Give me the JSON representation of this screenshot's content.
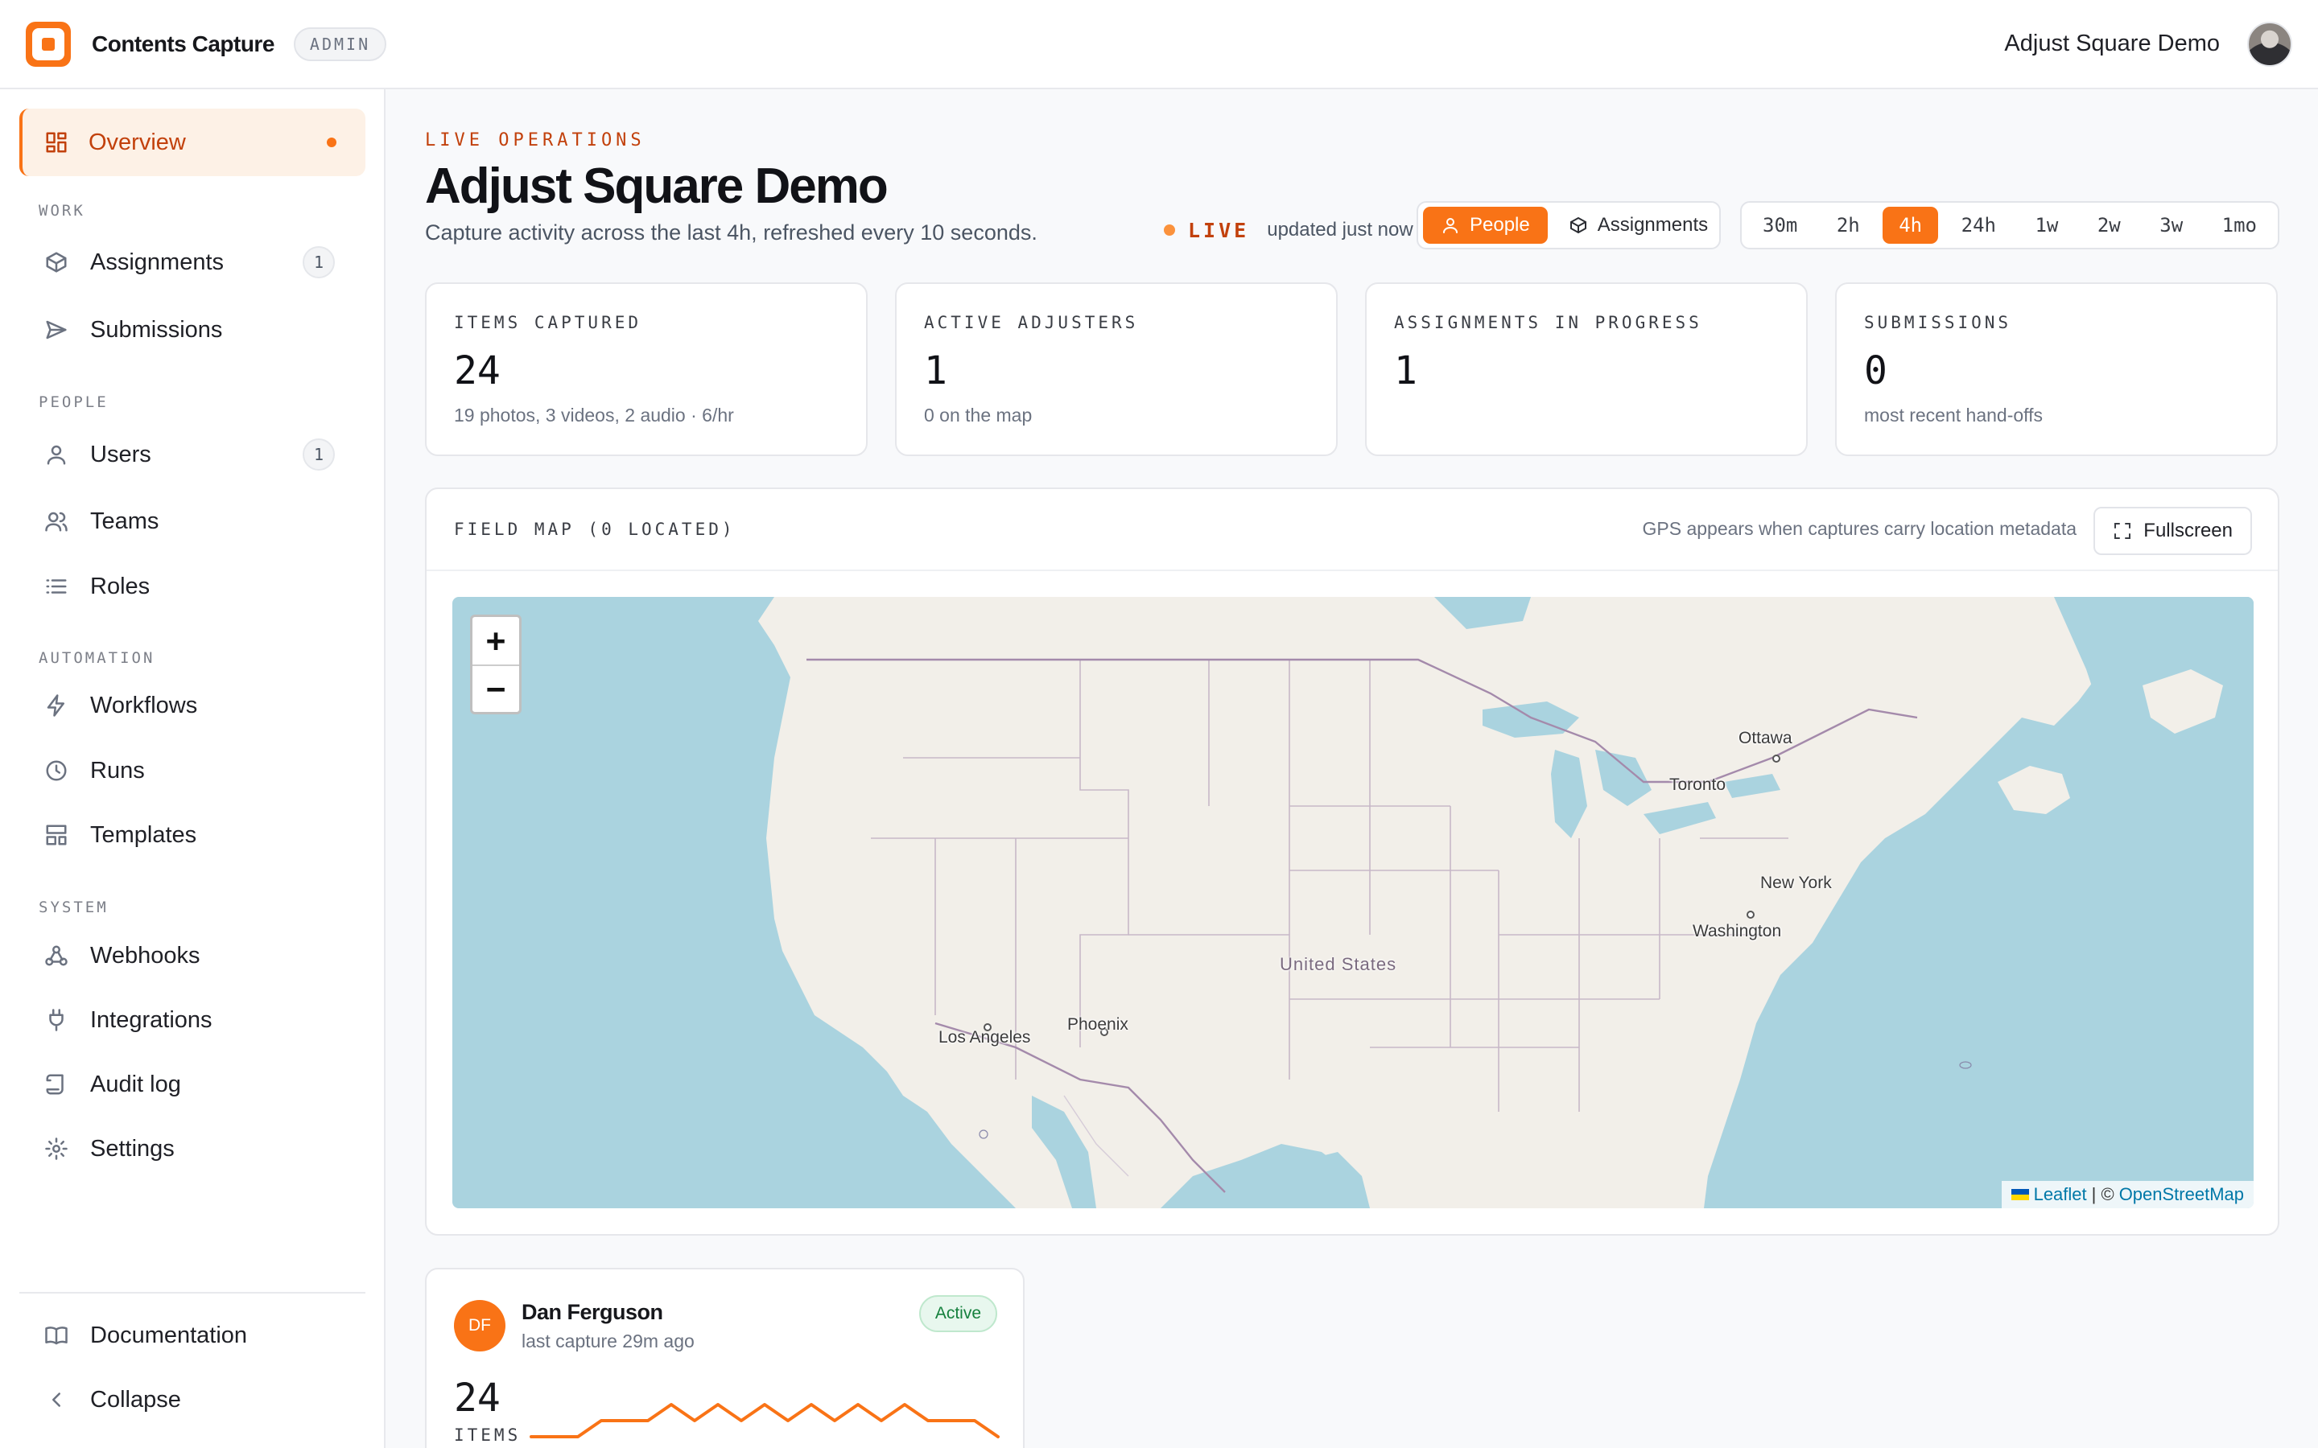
{
  "app": {
    "name": "Contents Capture",
    "role_badge": "ADMIN"
  },
  "header": {
    "org_name": "Adjust Square Demo"
  },
  "sidebar": {
    "active": {
      "label": "Overview"
    },
    "sections": [
      {
        "title": "WORK",
        "items": [
          {
            "label": "Assignments",
            "badge": "1"
          },
          {
            "label": "Submissions"
          }
        ]
      },
      {
        "title": "PEOPLE",
        "items": [
          {
            "label": "Users",
            "badge": "1"
          },
          {
            "label": "Teams"
          },
          {
            "label": "Roles"
          }
        ]
      },
      {
        "title": "AUTOMATION",
        "items": [
          {
            "label": "Workflows"
          },
          {
            "label": "Runs"
          },
          {
            "label": "Templates"
          }
        ]
      },
      {
        "title": "SYSTEM",
        "items": [
          {
            "label": "Webhooks"
          },
          {
            "label": "Integrations"
          },
          {
            "label": "Audit log"
          },
          {
            "label": "Settings"
          }
        ]
      }
    ],
    "footer": {
      "docs": "Documentation",
      "collapse": "Collapse"
    }
  },
  "main": {
    "eyebrow": "LIVE OPERATIONS",
    "title": "Adjust Square Demo",
    "subtitle": "Capture activity across the last 4h, refreshed every 10 seconds.",
    "live": {
      "label": "LIVE",
      "updated": "updated just now"
    },
    "view_toggle": {
      "people": "People",
      "assignments": "Assignments",
      "selected": "People"
    },
    "ranges": [
      "30m",
      "2h",
      "4h",
      "24h",
      "1w",
      "2w",
      "3w",
      "1mo"
    ],
    "selected_range": "4h",
    "stats": [
      {
        "label": "ITEMS CAPTURED",
        "value": "24",
        "sub": "19 photos, 3 videos, 2 audio · 6/hr"
      },
      {
        "label": "ACTIVE ADJUSTERS",
        "value": "1",
        "sub": "0 on the map"
      },
      {
        "label": "ASSIGNMENTS IN PROGRESS",
        "value": "1",
        "sub": ""
      },
      {
        "label": "SUBMISSIONS",
        "value": "0",
        "sub": "most recent hand-offs"
      }
    ],
    "map": {
      "title": "FIELD MAP (0 LOCATED)",
      "hint": "GPS appears when captures carry location metadata",
      "fullscreen": "Fullscreen",
      "zoom_in": "+",
      "zoom_out": "−",
      "attribution": {
        "leaflet": "Leaflet",
        "separator": "| ©",
        "osm": "OpenStreetMap"
      },
      "labels": {
        "ottawa": "Ottawa",
        "toronto": "Toronto",
        "new_york": "New York",
        "washington": "Washington",
        "united_states": "United States",
        "phoenix": "Phoenix",
        "los_angeles": "Los Angeles"
      }
    },
    "people": [
      {
        "initials": "DF",
        "name": "Dan Ferguson",
        "last_capture": "last capture 29m ago",
        "status": "Active",
        "count": "24",
        "unit": "ITEMS",
        "sparkline": [
          0,
          0,
          0,
          1,
          1,
          1,
          2,
          1,
          2,
          1,
          2,
          1,
          2,
          1,
          2,
          1,
          2,
          1,
          1,
          1,
          0
        ]
      }
    ]
  },
  "colors": {
    "accent": "#f97316",
    "accent_text": "#c2410c",
    "success": "#15803d",
    "water": "#aad3df",
    "land": "#f2efe9"
  }
}
